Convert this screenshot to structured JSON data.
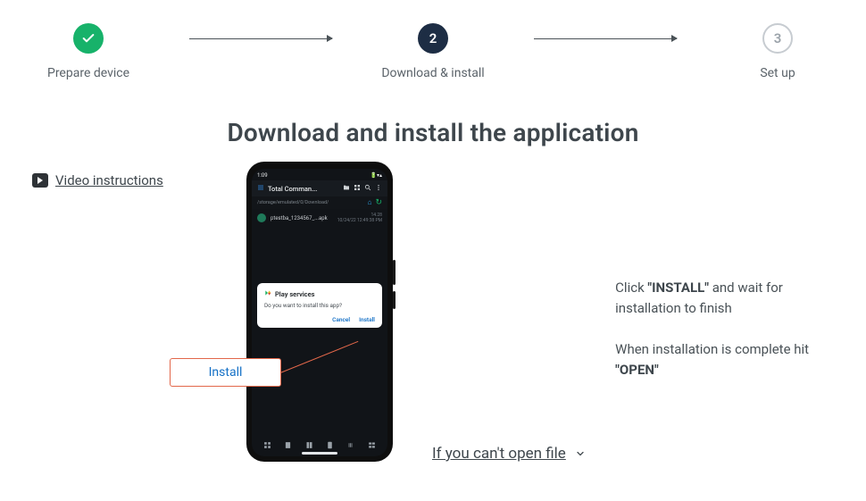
{
  "stepper": {
    "step1": {
      "label": "Prepare device"
    },
    "step2": {
      "num": "2",
      "label": "Download & install"
    },
    "step3": {
      "num": "3",
      "label": "Set up"
    }
  },
  "page_title": "Download and install the application",
  "video_link": " Video instructions",
  "phone": {
    "time": "1:09",
    "status_right": "🔋▾▴",
    "app_title": "Total Comman...",
    "path": "/storage/emulated/0/Download/",
    "file_name": "ptestba_1234567_...apk",
    "file_size": "14.28",
    "file_date": "10/24/22 12:49:38 PM",
    "dialog_title": "Play services",
    "dialog_body": "Do you want to install this app?",
    "dialog_cancel": "Cancel",
    "dialog_install": "Install"
  },
  "callout_label": "Install",
  "instructions": {
    "p1_pre": "Click ",
    "p1_bold": "\"INSTALL\"",
    "p1_post": " and wait for installation to finish",
    "p2_pre": "When installation is complete hit ",
    "p2_bold": "\"OPEN\""
  },
  "cant_open_label": "If you can't open file"
}
